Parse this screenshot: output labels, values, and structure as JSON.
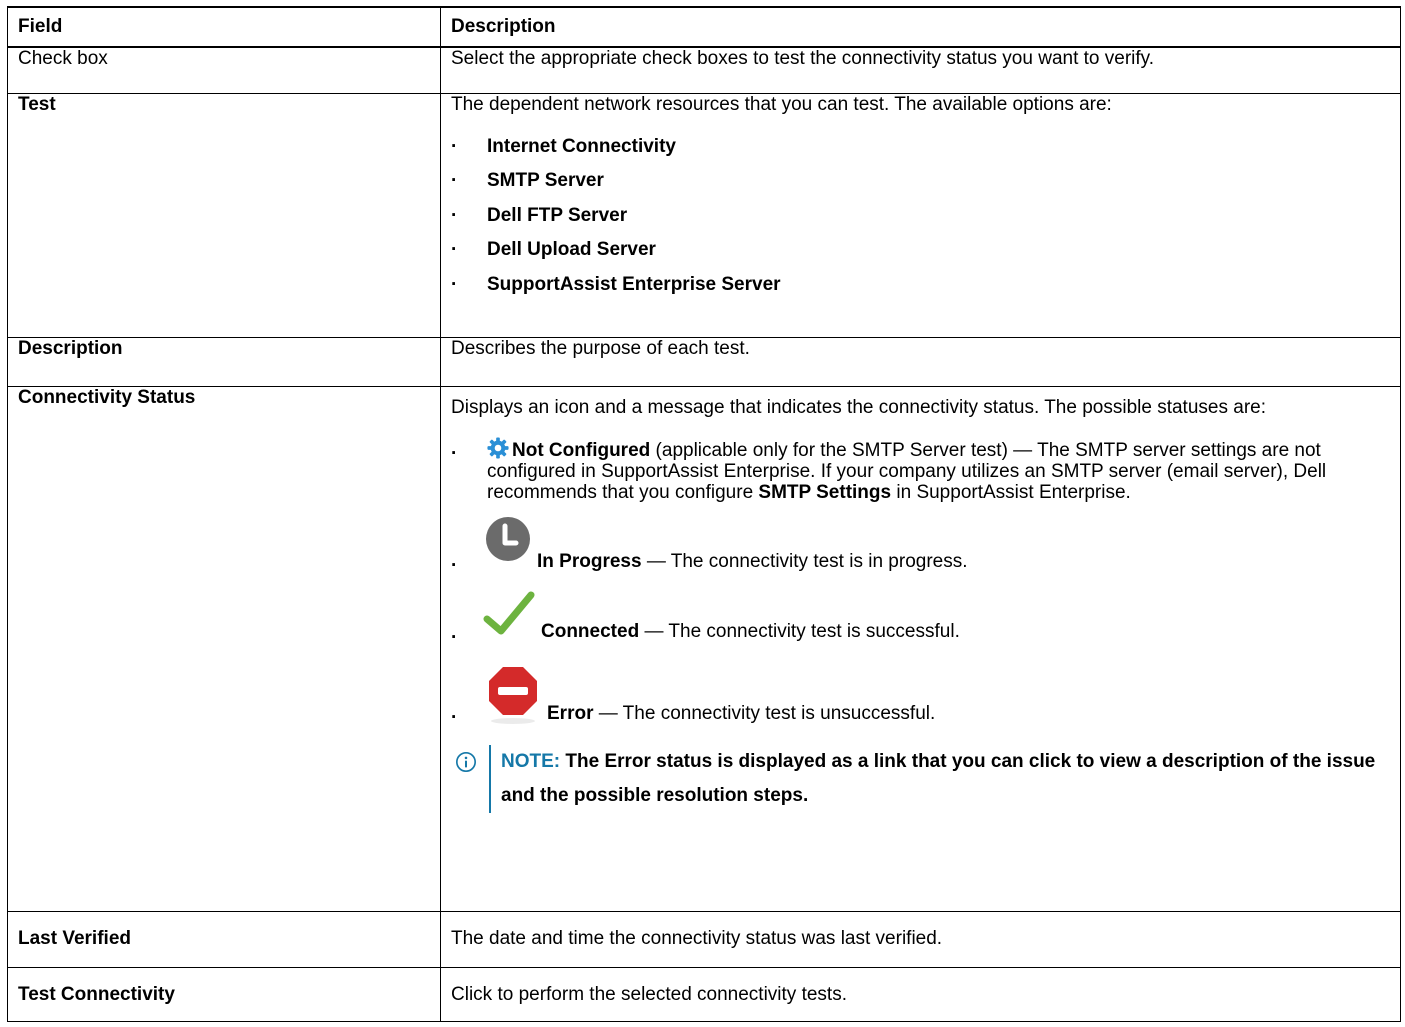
{
  "headers": {
    "field": "Field",
    "description": "Description"
  },
  "rows": {
    "checkbox": {
      "field": "Check box",
      "description": "Select the appropriate check boxes to test the connectivity status you want to verify."
    },
    "test": {
      "field": "Test",
      "description": "The dependent network resources that you can test. The available options are:",
      "options": [
        "Internet Connectivity",
        "SMTP Server",
        "Dell FTP Server",
        "Dell Upload Server",
        "SupportAssist Enterprise Server"
      ]
    },
    "description": {
      "field": "Description",
      "description": "Describes the purpose of each test."
    },
    "status": {
      "field": "Connectivity Status",
      "description": "Displays an icon and a message that indicates the connectivity status. The possible statuses are:",
      "not_configured": {
        "label": "Not Configured",
        "text_1": " (applicable only for the SMTP Server test) — The SMTP server settings are not configured in SupportAssist Enterprise. If your company utilizes an SMTP server (email server), Dell recommends that you configure ",
        "emphasis": "SMTP Settings",
        "text_2": " in SupportAssist Enterprise.",
        "icon": "gear-icon"
      },
      "in_progress": {
        "label": "In Progress",
        "text": " — The connectivity test is in progress.",
        "icon": "clock-icon"
      },
      "connected": {
        "label": "Connected",
        "text": " — The connectivity test is successful.",
        "icon": "checkmark-icon"
      },
      "error": {
        "label": "Error",
        "text": " — The connectivity test is unsuccessful.",
        "icon": "error-icon"
      },
      "note": {
        "label": "NOTE:",
        "text": " The Error status is displayed as a link that you can click to view a description of the issue and the possible resolution steps.",
        "icon": "info-icon"
      }
    },
    "last_verified": {
      "field": "Last Verified",
      "description": "The date and time the connectivity status was last verified."
    },
    "test_connectivity": {
      "field": "Test Connectivity",
      "description": "Click to perform the selected connectivity tests."
    }
  },
  "colors": {
    "note_accent": "#1578a8",
    "gear": "#2a8fd6",
    "clock": "#6b6b6b",
    "check": "#6db33f",
    "error": "#d42a2a"
  }
}
